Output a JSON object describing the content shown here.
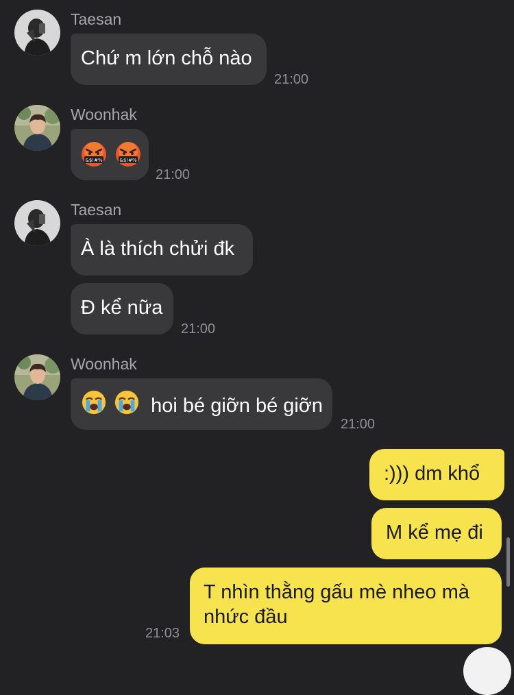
{
  "messages": [
    {
      "sender": "Taesan",
      "bubbles": [
        "Chứ m lớn chỗ nào"
      ],
      "time": "21:00"
    },
    {
      "sender": "Woonhak",
      "bubbles": [
        ""
      ],
      "emoji": [
        "angry-cursing-face",
        "angry-cursing-face"
      ],
      "time": "21:00"
    },
    {
      "sender": "Taesan",
      "bubbles": [
        "À là thích chửi đk",
        "Đ kể nữa"
      ],
      "time": "21:00"
    },
    {
      "sender": "Woonhak",
      "emoji": [
        "loudly-crying-face",
        "loudly-crying-face"
      ],
      "text": "hoi bé giỡn bé giỡn",
      "time": "21:00"
    }
  ],
  "outgoing": {
    "bubbles": [
      ":))) dm khổ",
      "M kể mẹ đi"
    ],
    "last_line1": "T nhìn thằng gấu mè nheo mà",
    "last_line2": "nhức đầu",
    "time": "21:03"
  },
  "colors": {
    "background": "#222224",
    "incoming_bubble": "#39393c",
    "outgoing_bubble": "#f7e34d",
    "timestamp": "#8f8f94",
    "sender_name": "#a7a7ab"
  }
}
